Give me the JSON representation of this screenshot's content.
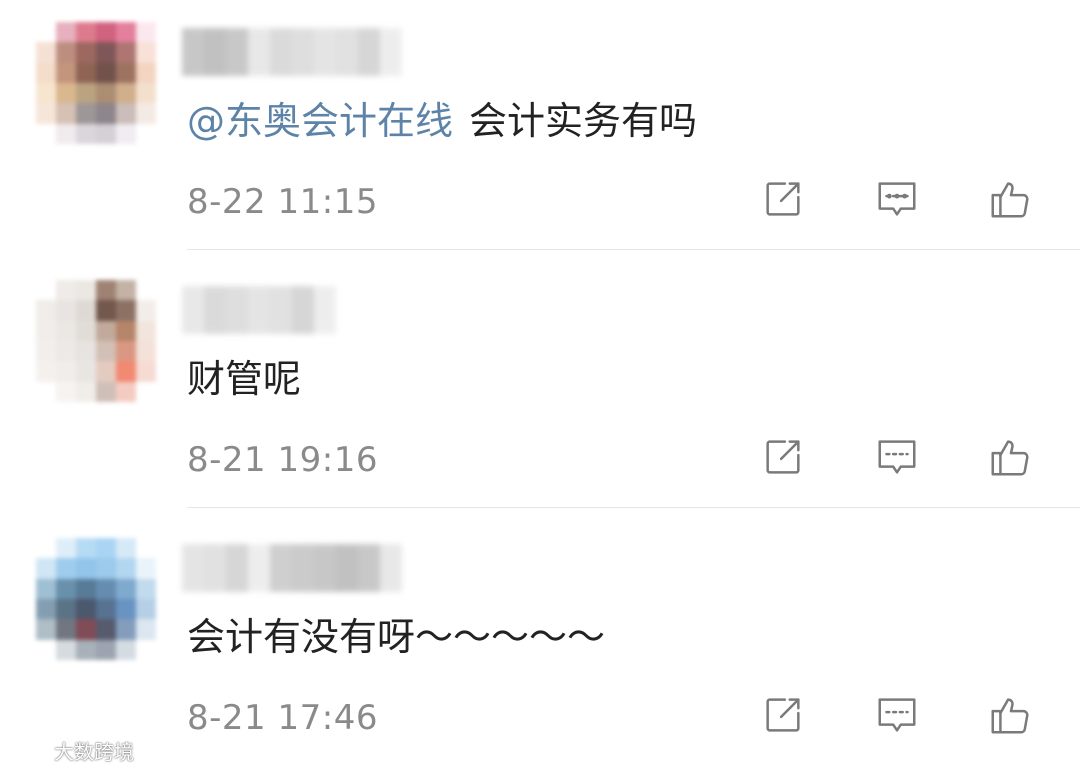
{
  "comments": [
    {
      "mention": "@东奥会计在线",
      "text": "会计实务有吗",
      "time": "8-22 11:15",
      "avatar_colors": [
        "#ffffff",
        "#e3a3b3",
        "#d8657a",
        "#c9476a",
        "#e06a8c",
        "#fbe5ec",
        "#f4dccd",
        "#b27b6a",
        "#8b4e45",
        "#6b3a3b",
        "#a15e5a",
        "#f7dcd0",
        "#f2d7c0",
        "#b98366",
        "#7c4a37",
        "#5b342d",
        "#8c5b45",
        "#f1cdb6",
        "#f6e1c8",
        "#d3ab7c",
        "#b0946b",
        "#9d7a5a",
        "#c9a078",
        "#f1dbc4",
        "#f4e2d3",
        "#cfb7a7",
        "#8e8585",
        "#7a7177",
        "#c2b2ad",
        "#f3e7e0",
        "#ffffff",
        "#efe8ea",
        "#d4d0d6",
        "#cdc8cf",
        "#eeeaee",
        "#ffffff"
      ]
    },
    {
      "mention": "",
      "text": "财管呢",
      "time": "8-21 19:16",
      "avatar_colors": [
        "#ffffff",
        "#ece8e4",
        "#e8e4df",
        "#8f6d5b",
        "#b9a596",
        "#ffffff",
        "#eeeae6",
        "#e6e0dc",
        "#d9d3ce",
        "#5b3b2f",
        "#7a5a4a",
        "#f1ebe6",
        "#efebe7",
        "#e8e4e0",
        "#dcd7d2",
        "#b79c8b",
        "#a9704f",
        "#efe1d7",
        "#f0ece8",
        "#eae6e2",
        "#e3dfdb",
        "#cbb6aa",
        "#d3866c",
        "#f3ddd3",
        "#f3efeb",
        "#efebe7",
        "#e6e2de",
        "#e0c2b6",
        "#f0755a",
        "#f5d5cc",
        "#ffffff",
        "#f5f2ef",
        "#efeae6",
        "#c8b4ad",
        "#f3c3b6",
        "#ffffff"
      ]
    },
    {
      "mention": "",
      "text": "会计有没有呀～～～～～",
      "time": "8-21 17:46",
      "avatar_colors": [
        "#ffffff",
        "#d9ecf8",
        "#a9d5f3",
        "#9ccdf1",
        "#cfe6f6",
        "#ffffff",
        "#c8e2f3",
        "#8fc4eb",
        "#7fbbe7",
        "#8ac1e9",
        "#a6cfee",
        "#e6f2fa",
        "#8fb4cc",
        "#4f7e9e",
        "#3c6485",
        "#4b7aa3",
        "#6a9bc6",
        "#b7d4ea",
        "#6d8ea3",
        "#3f5b72",
        "#2d3b55",
        "#3b5a80",
        "#4f81b8",
        "#a9c7e2",
        "#a1b2bd",
        "#5a5f6c",
        "#6b2d3a",
        "#3a3f55",
        "#6f8db0",
        "#d5e3ee",
        "#ffffff",
        "#cfd5da",
        "#9aa3ad",
        "#8b95a3",
        "#cdd6de",
        "#ffffff"
      ]
    }
  ],
  "icons": {
    "repost": "share-icon",
    "reply": "comment-icon",
    "like": "thumbs-up-icon"
  },
  "colors": {
    "mention": "#5d83a8",
    "text": "#222222",
    "time": "#8a8a8a",
    "icon": "#7a7a7a"
  },
  "watermark": {
    "text": "大数跨境"
  }
}
